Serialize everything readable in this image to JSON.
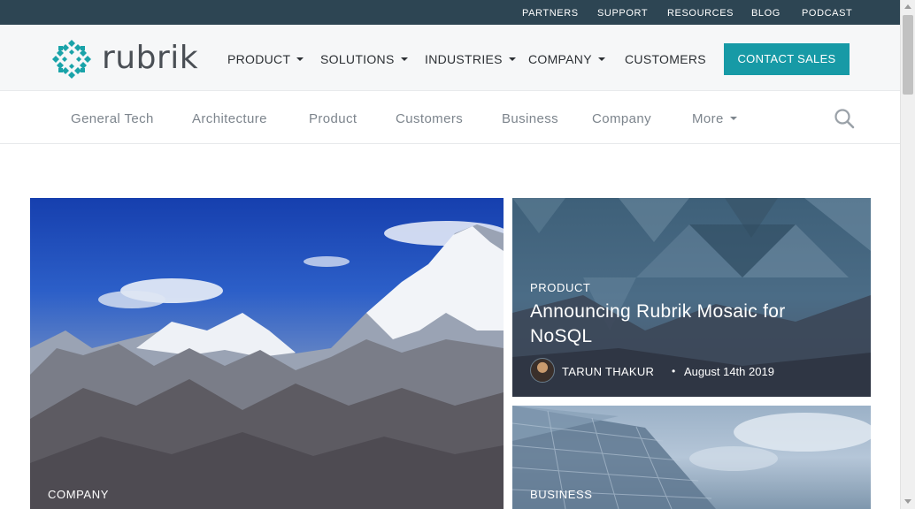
{
  "utility_nav": {
    "items": [
      {
        "label": "PARTNERS"
      },
      {
        "label": "SUPPORT"
      },
      {
        "label": "RESOURCES"
      },
      {
        "label": "BLOG"
      },
      {
        "label": "PODCAST"
      }
    ]
  },
  "header": {
    "logo_text": "rubrik",
    "nav": [
      {
        "label": "PRODUCT",
        "has_dropdown": true
      },
      {
        "label": "SOLUTIONS",
        "has_dropdown": true
      },
      {
        "label": "INDUSTRIES",
        "has_dropdown": true
      },
      {
        "label": "COMPANY",
        "has_dropdown": true
      },
      {
        "label": "CUSTOMERS",
        "has_dropdown": false
      }
    ],
    "cta_label": "CONTACT SALES"
  },
  "categories": {
    "items": [
      {
        "label": "General Tech"
      },
      {
        "label": "Architecture"
      },
      {
        "label": "Product"
      },
      {
        "label": "Customers"
      },
      {
        "label": "Business"
      },
      {
        "label": "Company"
      }
    ],
    "more_label": "More",
    "search_icon": "search-icon"
  },
  "posts": {
    "hero": {
      "category": "COMPANY"
    },
    "product": {
      "category": "PRODUCT",
      "title": "Announcing Rubrik Mosaic for NoSQL",
      "author": "TARUN THAKUR",
      "separator": "•",
      "date": "August 14th 2019"
    },
    "business": {
      "category": "BUSINESS"
    }
  },
  "colors": {
    "utility_bar": "#2d4553",
    "brand_teal": "#179aa6",
    "logo_teal": "#1aa3a9"
  }
}
